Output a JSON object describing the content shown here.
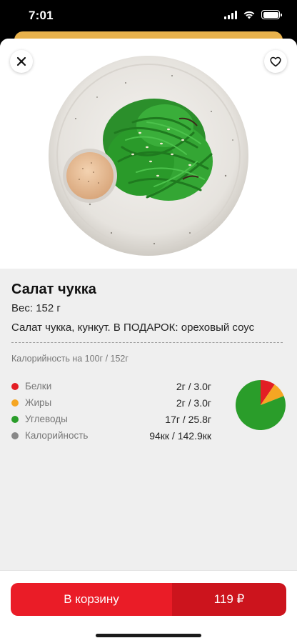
{
  "status_bar": {
    "time": "7:01"
  },
  "product": {
    "title": "Салат чукка",
    "weight_label": "Вес:",
    "weight_value": "152 г",
    "description": "Салат чукка, кункут. В ПОДАРОК: ореховый соус"
  },
  "nutrition": {
    "header": "Калорийность на 100г / 152г",
    "rows": [
      {
        "label": "Белки",
        "value": "2г / 3.0г",
        "color": "#e31e24"
      },
      {
        "label": "Жиры",
        "value": "2г / 3.0г",
        "color": "#f5a623"
      },
      {
        "label": "Углеводы",
        "value": "17г / 25.8г",
        "color": "#2a9d2a"
      },
      {
        "label": "Калорийность",
        "value": "94кк / 142.9кк",
        "color": "#888888"
      }
    ]
  },
  "chart_data": {
    "type": "pie",
    "categories": [
      "Белки",
      "Жиры",
      "Углеводы"
    ],
    "values": [
      2,
      2,
      17
    ],
    "colors": [
      "#e31e24",
      "#f5a623",
      "#2a9d2a"
    ]
  },
  "cart": {
    "label": "В корзину",
    "price": "119 ₽"
  },
  "icons": [
    "close-icon",
    "heart-icon",
    "wifi-icon",
    "battery-icon",
    "signal-icon"
  ],
  "colors": {
    "accent": "#ea1c27",
    "accent_dark": "#cc141d",
    "back_sheet": "#e8b24c"
  }
}
